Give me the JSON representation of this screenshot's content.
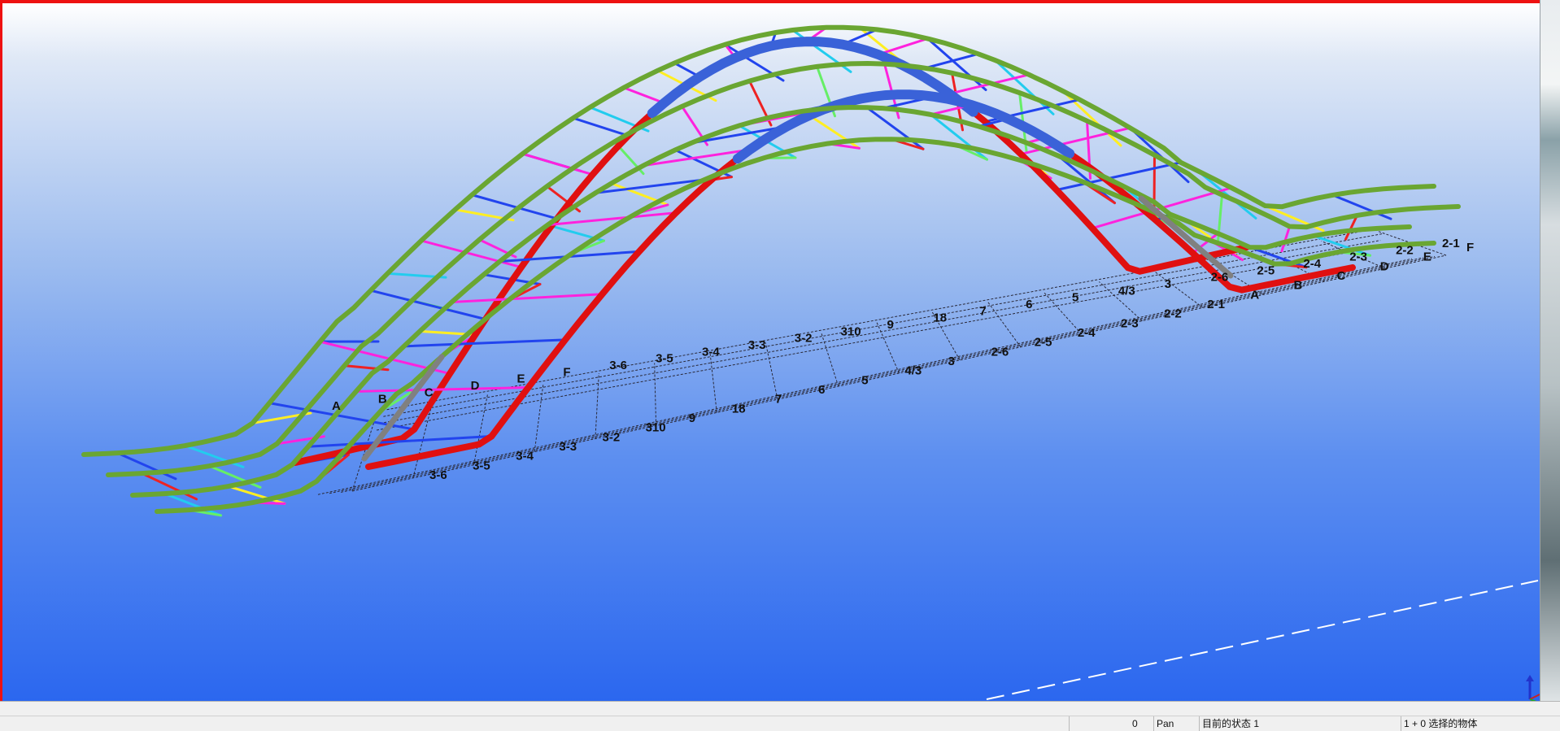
{
  "viewport": {
    "labels_near_row": [
      "A",
      "B",
      "C",
      "D",
      "E",
      "F",
      "3-6",
      "3-5",
      "3-4",
      "3-3",
      "3-2",
      "310",
      "9",
      "18",
      "7",
      "6",
      "5",
      "4/3",
      "3",
      "2-6",
      "2-5",
      "2-4",
      "2-3",
      "2-2",
      "2-1"
    ],
    "labels_far_row": [
      "3-6",
      "3-5",
      "3-4",
      "3-3",
      "3-2",
      "310",
      "9",
      "18",
      "7",
      "6",
      "5",
      "4/3",
      "3",
      "2-6",
      "2-5",
      "2-4",
      "2-3",
      "2-2",
      "2-1",
      "A",
      "B",
      "C",
      "D",
      "E",
      "F"
    ]
  },
  "statusbar": {
    "count": "0",
    "mode": "Pan",
    "state": "目前的状态 1",
    "selection": "1 + 0 选择的物体"
  }
}
